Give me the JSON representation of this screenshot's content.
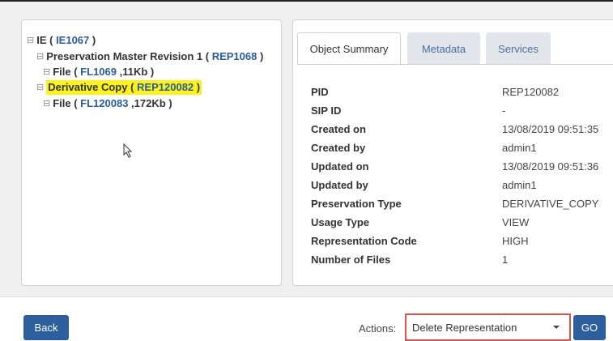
{
  "tree": {
    "ie": {
      "expander": "⊟",
      "prefix": "IE ( ",
      "id": "IE1067",
      "suffix": " )"
    },
    "rep1": {
      "expander": "⊟",
      "prefix": "Preservation Master Revision 1 ( ",
      "id": "REP1068",
      "suffix": " )"
    },
    "file1": {
      "expander": "⊟",
      "prefix": "File ( ",
      "id": "FL1069",
      "suffix": " ,11Kb )"
    },
    "rep2": {
      "expander": "⊟",
      "prefix": "Derivative Copy ( ",
      "id": "REP120082",
      "suffix": " )"
    },
    "file2": {
      "expander": "⊟",
      "prefix": "File ( ",
      "id": "FL120083",
      "suffix": " ,172Kb )"
    }
  },
  "tabs": {
    "summary": "Object Summary",
    "metadata": "Metadata",
    "services": "Services"
  },
  "summary": [
    {
      "key": "PID",
      "value": "REP120082"
    },
    {
      "key": "SIP ID",
      "value": "-"
    },
    {
      "key": "Created on",
      "value": "13/08/2019 09:51:35"
    },
    {
      "key": "Created by",
      "value": "admin1"
    },
    {
      "key": "Updated on",
      "value": "13/08/2019 09:51:36"
    },
    {
      "key": "Updated by",
      "value": "admin1"
    },
    {
      "key": "Preservation Type",
      "value": "DERIVATIVE_COPY"
    },
    {
      "key": "Usage Type",
      "value": "VIEW"
    },
    {
      "key": "Representation Code",
      "value": "HIGH"
    },
    {
      "key": "Number of Files",
      "value": "1"
    }
  ],
  "footer": {
    "back_label": "Back",
    "actions_label": "Actions:",
    "actions_selected": "Delete Representation",
    "go_label": "GO"
  },
  "colors": {
    "highlight": "#fbf21d",
    "link": "#2a5c9e",
    "button": "#2d5f9e",
    "select_border": "#d9534f"
  }
}
